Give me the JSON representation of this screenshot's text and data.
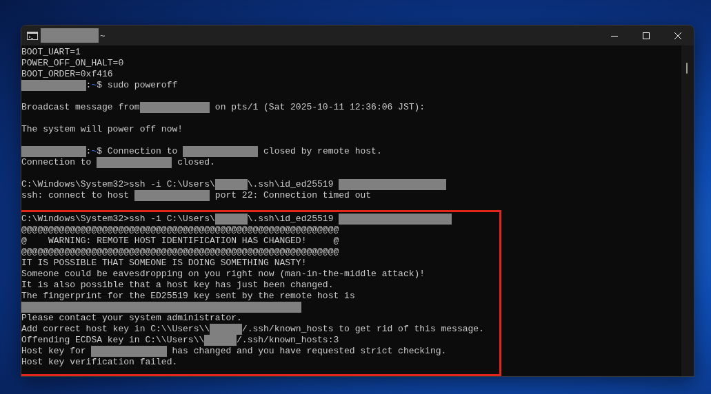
{
  "window": {
    "title": [
      {
        "kind": "redacted"
      },
      {
        "kind": "text",
        "text": "~"
      }
    ]
  },
  "terminal": {
    "lines": [
      {
        "kind": "output",
        "segments": [
          {
            "kind": "text",
            "text": "BOOT_UART=1"
          }
        ]
      },
      {
        "kind": "output",
        "segments": [
          {
            "kind": "text",
            "text": "POWER_OFF_ON_HALT=0"
          }
        ]
      },
      {
        "kind": "output",
        "segments": [
          {
            "kind": "text",
            "text": "BOOT_ORDER=0xf416"
          }
        ]
      },
      {
        "kind": "output",
        "segments": [
          {
            "kind": "redacted"
          },
          {
            "kind": "text",
            "text": ":"
          },
          {
            "kind": "path",
            "text": "~"
          },
          {
            "kind": "text",
            "text": "$ sudo poweroff"
          }
        ]
      },
      {
        "kind": "blank"
      },
      {
        "kind": "output",
        "segments": [
          {
            "kind": "text",
            "text": "Broadcast message from"
          },
          {
            "kind": "redacted"
          },
          {
            "kind": "text",
            "text": " on pts/1 (Sat 2025-10-11 12:36:06 JST):"
          }
        ]
      },
      {
        "kind": "blank"
      },
      {
        "kind": "output",
        "segments": [
          {
            "kind": "text",
            "text": "The system will power off now!"
          }
        ]
      },
      {
        "kind": "blank"
      },
      {
        "kind": "output",
        "segments": [
          {
            "kind": "redacted"
          },
          {
            "kind": "text",
            "text": ":"
          },
          {
            "kind": "path",
            "text": "~"
          },
          {
            "kind": "text",
            "text": "$ Connection to "
          },
          {
            "kind": "redacted"
          },
          {
            "kind": "text",
            "text": " closed by remote host."
          }
        ]
      },
      {
        "kind": "output",
        "segments": [
          {
            "kind": "text",
            "text": "Connection to "
          },
          {
            "kind": "redacted"
          },
          {
            "kind": "text",
            "text": " closed."
          }
        ]
      },
      {
        "kind": "blank"
      },
      {
        "kind": "output",
        "segments": [
          {
            "kind": "text",
            "text": "C:\\Windows\\System32>ssh -i C:\\Users\\"
          },
          {
            "kind": "redacted"
          },
          {
            "kind": "text",
            "text": "\\.ssh\\id_ed25519 "
          },
          {
            "kind": "redacted"
          }
        ]
      },
      {
        "kind": "output",
        "segments": [
          {
            "kind": "text",
            "text": "ssh: connect to host "
          },
          {
            "kind": "redacted"
          },
          {
            "kind": "text",
            "text": " port 22: Connection timed out"
          }
        ]
      },
      {
        "kind": "blank"
      }
    ],
    "highlighted_lines": [
      {
        "kind": "output",
        "segments": [
          {
            "kind": "text",
            "text": "C:\\Windows\\System32>ssh -i C:\\Users\\"
          },
          {
            "kind": "redacted"
          },
          {
            "kind": "text",
            "text": "\\.ssh\\id_ed25519 "
          },
          {
            "kind": "redacted"
          }
        ]
      },
      {
        "kind": "output",
        "segments": [
          {
            "kind": "text",
            "text": "@@@@@@@@@@@@@@@@@@@@@@@@@@@@@@@@@@@@@@@@@@@@@@@@@@@@@@@@@@@"
          }
        ]
      },
      {
        "kind": "output",
        "segments": [
          {
            "kind": "text",
            "text": "@    WARNING: REMOTE HOST IDENTIFICATION HAS CHANGED!     @"
          }
        ]
      },
      {
        "kind": "output",
        "segments": [
          {
            "kind": "text",
            "text": "@@@@@@@@@@@@@@@@@@@@@@@@@@@@@@@@@@@@@@@@@@@@@@@@@@@@@@@@@@@"
          }
        ]
      },
      {
        "kind": "output",
        "segments": [
          {
            "kind": "text",
            "text": "IT IS POSSIBLE THAT SOMEONE IS DOING SOMETHING NASTY!"
          }
        ]
      },
      {
        "kind": "output",
        "segments": [
          {
            "kind": "text",
            "text": "Someone could be eavesdropping on you right now (man-in-the-middle attack)!"
          }
        ]
      },
      {
        "kind": "output",
        "segments": [
          {
            "kind": "text",
            "text": "It is also possible that a host key has just been changed."
          }
        ]
      },
      {
        "kind": "output",
        "segments": [
          {
            "kind": "text",
            "text": "The fingerprint for the ED25519 key sent by the remote host is"
          }
        ]
      },
      {
        "kind": "output",
        "segments": [
          {
            "kind": "redacted"
          }
        ]
      },
      {
        "kind": "output",
        "segments": [
          {
            "kind": "text",
            "text": "Please contact your system administrator."
          }
        ]
      },
      {
        "kind": "output",
        "segments": [
          {
            "kind": "text",
            "text": "Add correct host key in C:\\\\Users\\\\"
          },
          {
            "kind": "redacted"
          },
          {
            "kind": "text",
            "text": "/.ssh/known_hosts to get rid of this message."
          }
        ]
      },
      {
        "kind": "output",
        "segments": [
          {
            "kind": "text",
            "text": "Offending ECDSA key in C:\\\\Users\\\\"
          },
          {
            "kind": "redacted"
          },
          {
            "kind": "text",
            "text": "/.ssh/known_hosts:3"
          }
        ]
      },
      {
        "kind": "output",
        "segments": [
          {
            "kind": "text",
            "text": "Host key for "
          },
          {
            "kind": "redacted"
          },
          {
            "kind": "text",
            "text": " has changed and you have requested strict checking."
          }
        ]
      },
      {
        "kind": "output",
        "segments": [
          {
            "kind": "text",
            "text": "Host key verification failed."
          }
        ]
      }
    ]
  }
}
